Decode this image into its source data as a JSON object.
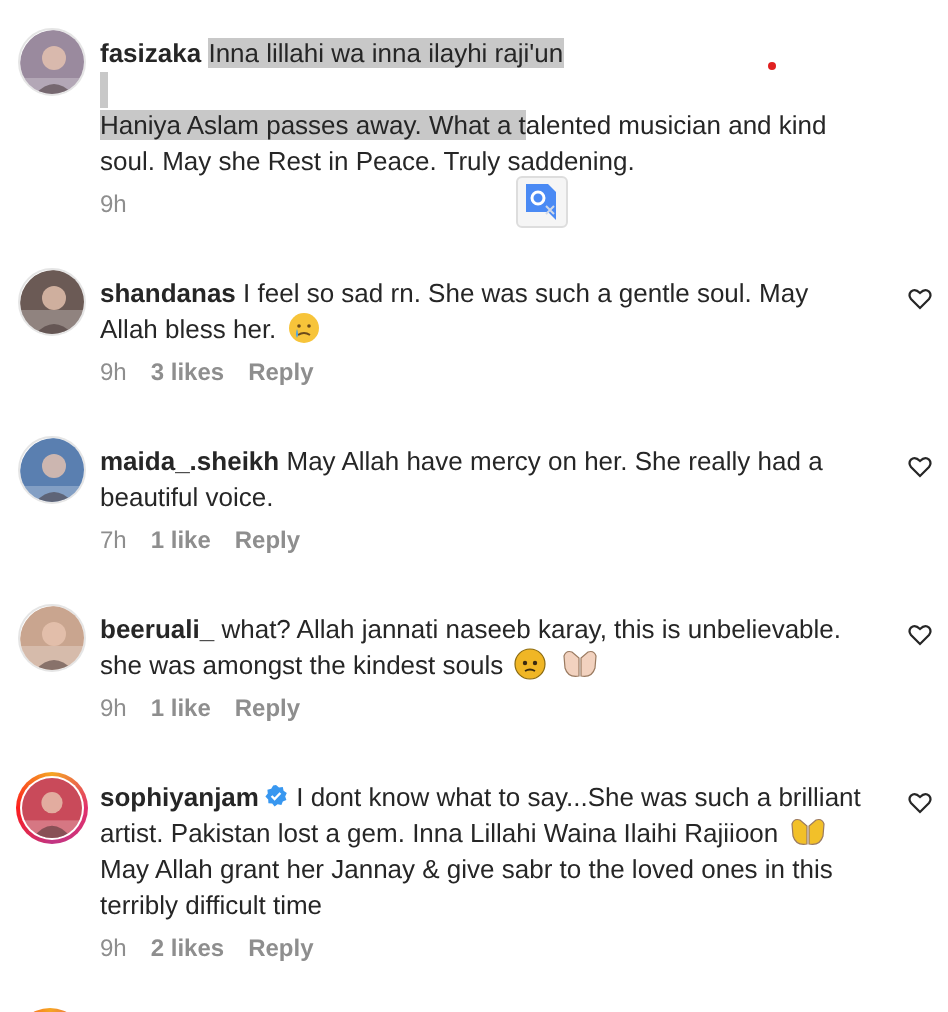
{
  "comments": [
    {
      "username": "fasizaka",
      "verified": false,
      "story_ring": false,
      "like_button": false,
      "translate_popup": true,
      "time": "9h",
      "segments": [
        {
          "kind": "text",
          "text": "Inna lillahi wa inna ilayhi raji'un",
          "selected": true
        },
        {
          "kind": "line_break",
          "selected": true
        },
        {
          "kind": "text",
          "text": "Haniya Aslam passes away. What a t",
          "selected": true
        },
        {
          "kind": "text",
          "text": "alented musician and kind soul. May she Rest in Peace. Truly saddening.",
          "selected": false
        }
      ]
    },
    {
      "username": "shandanas",
      "verified": false,
      "story_ring": false,
      "like_button": true,
      "translate_popup": false,
      "time": "9h",
      "likes": "3 likes",
      "reply": "Reply",
      "segments": [
        {
          "kind": "text",
          "text": "I feel so sad rn. She was such a gentle soul. May Allah bless her.",
          "selected": false
        },
        {
          "kind": "crying_emoji",
          "selected": false
        }
      ]
    },
    {
      "username": "maida_.sheikh",
      "verified": false,
      "story_ring": false,
      "like_button": true,
      "translate_popup": false,
      "time": "7h",
      "likes": "1 like",
      "reply": "Reply",
      "segments": [
        {
          "kind": "text",
          "text": "May Allah have mercy on her. She really had a beautiful voice.",
          "selected": false
        }
      ]
    },
    {
      "username": "beeruali_",
      "verified": false,
      "story_ring": false,
      "like_button": true,
      "translate_popup": false,
      "time": "9h",
      "likes": "1 like",
      "reply": "Reply",
      "segments": [
        {
          "kind": "text",
          "text": "what? Allah jannati naseeb karay, this is unbelievable. she was amongst the kindest souls",
          "selected": false
        },
        {
          "kind": "worried_emoji",
          "selected": false
        },
        {
          "kind": "palms_emoji",
          "selected": false
        }
      ]
    },
    {
      "username": "sophiyanjam",
      "verified": true,
      "story_ring": true,
      "like_button": true,
      "translate_popup": false,
      "time": "9h",
      "likes": "2 likes",
      "reply": "Reply",
      "segments": [
        {
          "kind": "text",
          "text": "I dont know what to say...She was such a brilliant artist. Pakistan lost a gem. Inna Lillahi Waina Ilaihi Rajiioon",
          "selected": false
        },
        {
          "kind": "yellow_palms_emoji",
          "selected": false
        },
        {
          "kind": "text",
          "text": "May Allah grant her Jannay & give sabr to the loved ones in this terribly difficult time",
          "selected": false
        }
      ]
    }
  ],
  "next_comment": {
    "story_ring": true
  }
}
